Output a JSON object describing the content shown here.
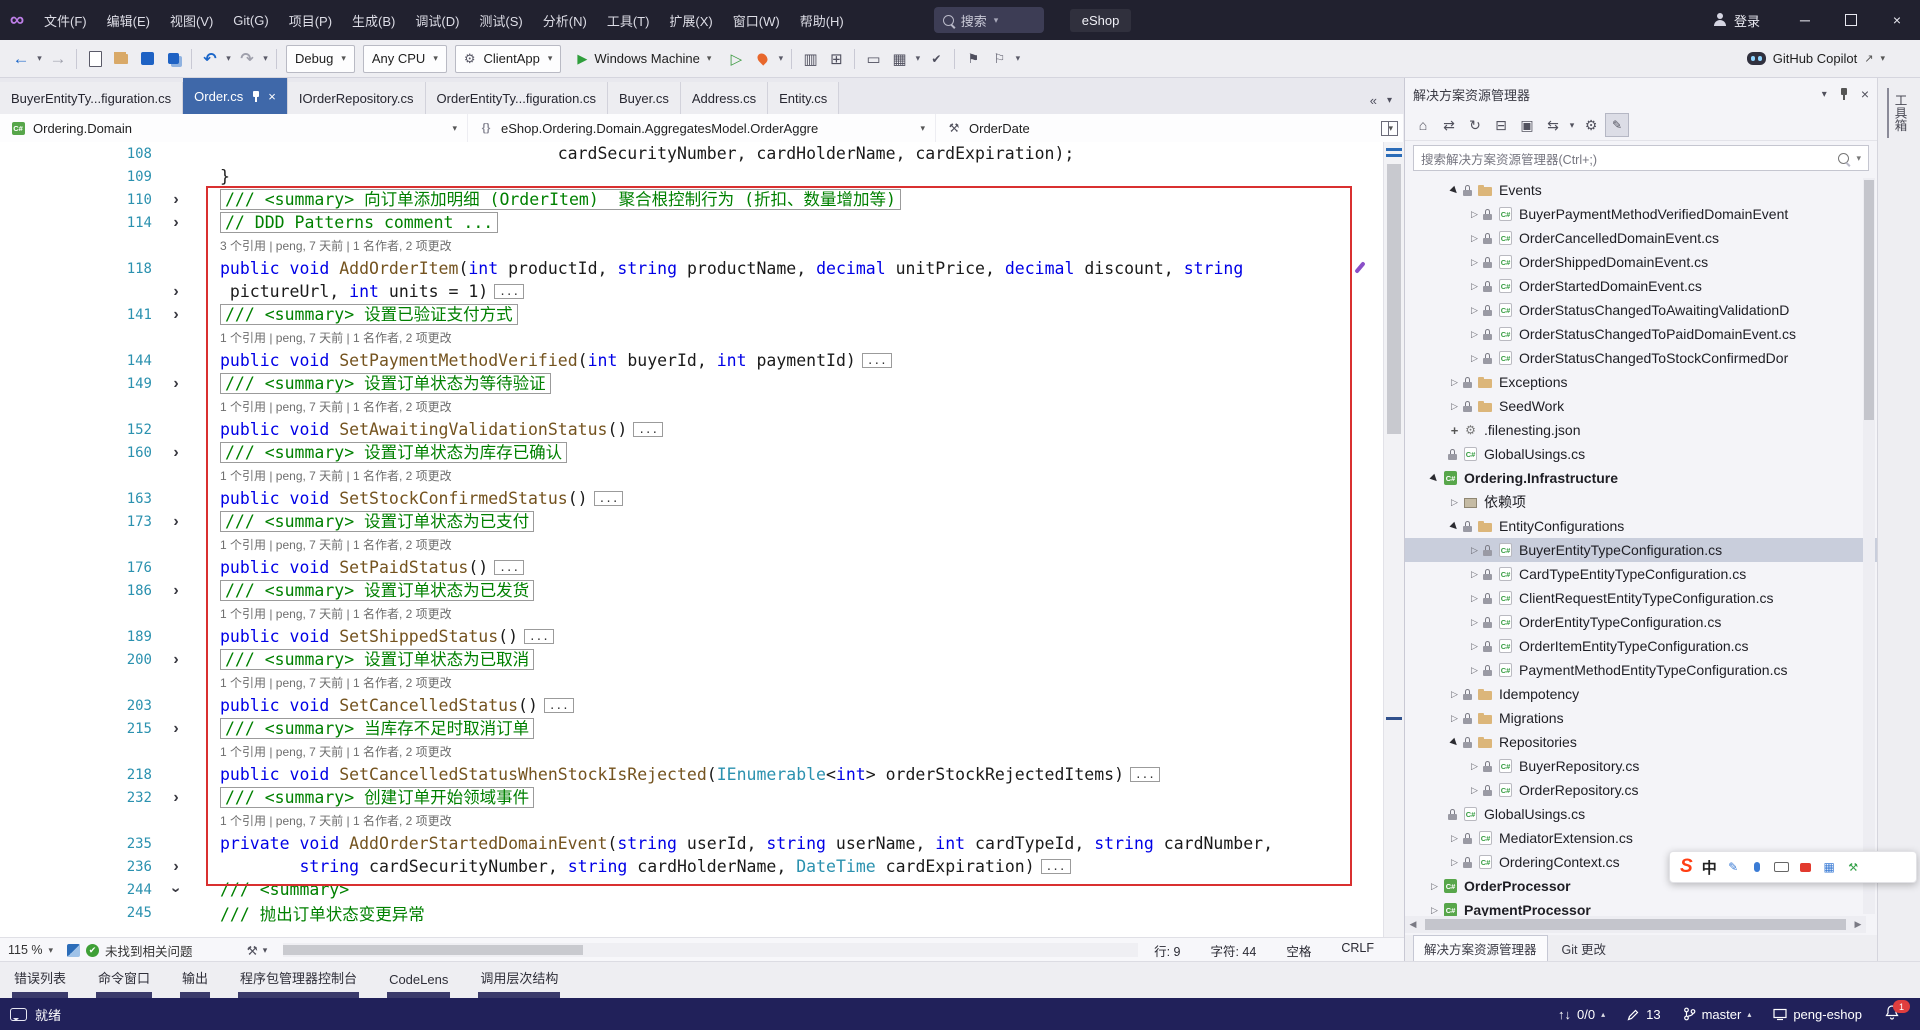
{
  "titlebar": {
    "menus": [
      "文件(F)",
      "编辑(E)",
      "视图(V)",
      "Git(G)",
      "项目(P)",
      "生成(B)",
      "调试(D)",
      "测试(S)",
      "分析(N)",
      "工具(T)",
      "扩展(X)",
      "窗口(W)",
      "帮助(H)"
    ],
    "search_label": "搜索",
    "solution": "eShop",
    "signin": "登录"
  },
  "toolbar": {
    "icons_a": [
      "back-icon",
      "caret-icon",
      "forward-icon",
      "separator",
      "new-file-icon",
      "open-folder-icon",
      "save-icon",
      "save-all-icon",
      "separator",
      "undo-icon",
      "caret-icon",
      "redo-icon",
      "caret-icon",
      "separator"
    ],
    "icons_b": [
      "play-outline-icon",
      "hot-reload-icon",
      "caret-icon",
      "separator",
      "profiler-icon",
      "pages-icon",
      "separator",
      "monitor-icon",
      "grid-icon",
      "caret-icon",
      "spell-icon",
      "separator",
      "bookmark-icon",
      "flag-icon",
      "caret-icon"
    ],
    "config": "Debug",
    "platform": "Any CPU",
    "profile": "ClientApp",
    "run_label": "Windows Machine",
    "copilot_label": "GitHub Copilot"
  },
  "tabs": [
    {
      "label": "BuyerEntityTy...figuration.cs",
      "state": ""
    },
    {
      "label": "Order.cs",
      "state": "active"
    },
    {
      "label": "IOrderRepository.cs",
      "state": ""
    },
    {
      "label": "OrderEntityTy...figuration.cs",
      "state": ""
    },
    {
      "label": "Buyer.cs",
      "state": ""
    },
    {
      "label": "Address.cs",
      "state": ""
    },
    {
      "label": "Entity.cs",
      "state": ""
    }
  ],
  "breadcrumb": {
    "crumbs": [
      {
        "label": "Ordering.Domain",
        "icon": "project-icon"
      },
      {
        "label": "eShop.Ordering.Domain.AggregatesModel.OrderAggre",
        "icon": "namespace-icon"
      },
      {
        "label": "OrderDate",
        "icon": "property-icon"
      }
    ]
  },
  "editor": {
    "ellipsis": "...",
    "lines": [
      {
        "num": "108",
        "chev": "",
        "cls": "",
        "ell": false,
        "segs": [
          {
            "t": "                                  cardSecurityNumber, cardHolderName, cardExpiration);",
            "c": "pl"
          }
        ]
      },
      {
        "num": "109",
        "chev": "",
        "cls": "",
        "ell": false,
        "segs": [
          {
            "t": "}",
            "c": "pl"
          }
        ]
      },
      {
        "num": "110",
        "chev": "r",
        "cls": "boxed",
        "ell": false,
        "segs": [
          {
            "t": "/// <summary> 向订单添加明细 (OrderItem)  聚合根控制行为 (折扣、数量增加等)",
            "c": "cm"
          }
        ]
      },
      {
        "num": "114",
        "chev": "r",
        "cls": "boxed",
        "ell": false,
        "segs": [
          {
            "t": "// DDD Patterns comment ...",
            "c": "cm"
          }
        ]
      },
      {
        "num": "",
        "chev": "",
        "cls": "lens",
        "ell": false,
        "segs": [
          {
            "t": "3 个引用 | peng, 7 天前 | 1 名作者, 2 项更改",
            "c": "lens"
          }
        ]
      },
      {
        "num": "118",
        "chev": "",
        "cls": "",
        "ell": false,
        "segs": [
          {
            "t": "public void ",
            "c": "kw"
          },
          {
            "t": "AddOrderItem",
            "c": "m"
          },
          {
            "t": "(",
            "c": "pl"
          },
          {
            "t": "int",
            "c": "kw"
          },
          {
            "t": " productId, ",
            "c": "pl"
          },
          {
            "t": "string",
            "c": "kw"
          },
          {
            "t": " productName, ",
            "c": "pl"
          },
          {
            "t": "decimal",
            "c": "kw"
          },
          {
            "t": " unitPrice, ",
            "c": "pl"
          },
          {
            "t": "decimal",
            "c": "kw"
          },
          {
            "t": " discount, ",
            "c": "pl"
          },
          {
            "t": "string",
            "c": "kw"
          }
        ]
      },
      {
        "num": "",
        "chev": "r",
        "cls": "",
        "ell": true,
        "segs": [
          {
            "t": " pictureUrl, ",
            "c": "pl"
          },
          {
            "t": "int",
            "c": "kw"
          },
          {
            "t": " units = 1)",
            "c": "pl"
          }
        ]
      },
      {
        "num": "141",
        "chev": "r",
        "cls": "boxed",
        "ell": false,
        "segs": [
          {
            "t": "/// <summary> 设置已验证支付方式",
            "c": "cm"
          }
        ]
      },
      {
        "num": "",
        "chev": "",
        "cls": "lens",
        "ell": false,
        "segs": [
          {
            "t": "1 个引用 | peng, 7 天前 | 1 名作者, 2 项更改",
            "c": "lens"
          }
        ]
      },
      {
        "num": "144",
        "chev": "",
        "cls": "",
        "ell": true,
        "segs": [
          {
            "t": "public void ",
            "c": "kw"
          },
          {
            "t": "SetPaymentMethodVerified",
            "c": "m"
          },
          {
            "t": "(",
            "c": "pl"
          },
          {
            "t": "int",
            "c": "kw"
          },
          {
            "t": " buyerId, ",
            "c": "pl"
          },
          {
            "t": "int",
            "c": "kw"
          },
          {
            "t": " paymentId)",
            "c": "pl"
          }
        ]
      },
      {
        "num": "149",
        "chev": "r",
        "cls": "boxed",
        "ell": false,
        "segs": [
          {
            "t": "/// <summary> 设置订单状态为等待验证",
            "c": "cm"
          }
        ]
      },
      {
        "num": "",
        "chev": "",
        "cls": "lens",
        "ell": false,
        "segs": [
          {
            "t": "1 个引用 | peng, 7 天前 | 1 名作者, 2 项更改",
            "c": "lens"
          }
        ]
      },
      {
        "num": "152",
        "chev": "",
        "cls": "",
        "ell": true,
        "segs": [
          {
            "t": "public void ",
            "c": "kw"
          },
          {
            "t": "SetAwaitingValidationStatus",
            "c": "m"
          },
          {
            "t": "()",
            "c": "pl"
          }
        ]
      },
      {
        "num": "160",
        "chev": "r",
        "cls": "boxed",
        "ell": false,
        "segs": [
          {
            "t": "/// <summary> 设置订单状态为库存已确认",
            "c": "cm"
          }
        ]
      },
      {
        "num": "",
        "chev": "",
        "cls": "lens",
        "ell": false,
        "segs": [
          {
            "t": "1 个引用 | peng, 7 天前 | 1 名作者, 2 项更改",
            "c": "lens"
          }
        ]
      },
      {
        "num": "163",
        "chev": "",
        "cls": "",
        "ell": true,
        "segs": [
          {
            "t": "public void ",
            "c": "kw"
          },
          {
            "t": "SetStockConfirmedStatus",
            "c": "m"
          },
          {
            "t": "()",
            "c": "pl"
          }
        ]
      },
      {
        "num": "173",
        "chev": "r",
        "cls": "boxed",
        "ell": false,
        "segs": [
          {
            "t": "/// <summary> 设置订单状态为已支付",
            "c": "cm"
          }
        ]
      },
      {
        "num": "",
        "chev": "",
        "cls": "lens",
        "ell": false,
        "segs": [
          {
            "t": "1 个引用 | peng, 7 天前 | 1 名作者, 2 项更改",
            "c": "lens"
          }
        ]
      },
      {
        "num": "176",
        "chev": "",
        "cls": "",
        "ell": true,
        "segs": [
          {
            "t": "public void ",
            "c": "kw"
          },
          {
            "t": "SetPaidStatus",
            "c": "m"
          },
          {
            "t": "()",
            "c": "pl"
          }
        ]
      },
      {
        "num": "186",
        "chev": "r",
        "cls": "boxed",
        "ell": false,
        "segs": [
          {
            "t": "/// <summary> 设置订单状态为已发货",
            "c": "cm"
          }
        ]
      },
      {
        "num": "",
        "chev": "",
        "cls": "lens",
        "ell": false,
        "segs": [
          {
            "t": "1 个引用 | peng, 7 天前 | 1 名作者, 2 项更改",
            "c": "lens"
          }
        ]
      },
      {
        "num": "189",
        "chev": "",
        "cls": "",
        "ell": true,
        "segs": [
          {
            "t": "public void ",
            "c": "kw"
          },
          {
            "t": "SetShippedStatus",
            "c": "m"
          },
          {
            "t": "()",
            "c": "pl"
          }
        ]
      },
      {
        "num": "200",
        "chev": "r",
        "cls": "boxed",
        "ell": false,
        "segs": [
          {
            "t": "/// <summary> 设置订单状态为已取消",
            "c": "cm"
          }
        ]
      },
      {
        "num": "",
        "chev": "",
        "cls": "lens",
        "ell": false,
        "segs": [
          {
            "t": "1 个引用 | peng, 7 天前 | 1 名作者, 2 项更改",
            "c": "lens"
          }
        ]
      },
      {
        "num": "203",
        "chev": "",
        "cls": "",
        "ell": true,
        "segs": [
          {
            "t": "public void ",
            "c": "kw"
          },
          {
            "t": "SetCancelledStatus",
            "c": "m"
          },
          {
            "t": "()",
            "c": "pl"
          }
        ]
      },
      {
        "num": "215",
        "chev": "r",
        "cls": "boxed",
        "ell": false,
        "segs": [
          {
            "t": "/// <summary> 当库存不足时取消订单",
            "c": "cm"
          }
        ]
      },
      {
        "num": "",
        "chev": "",
        "cls": "lens",
        "ell": false,
        "segs": [
          {
            "t": "1 个引用 | peng, 7 天前 | 1 名作者, 2 项更改",
            "c": "lens"
          }
        ]
      },
      {
        "num": "218",
        "chev": "",
        "cls": "",
        "ell": true,
        "segs": [
          {
            "t": "public void ",
            "c": "kw"
          },
          {
            "t": "SetCancelledStatusWhenStockIsRejected",
            "c": "m"
          },
          {
            "t": "(",
            "c": "pl"
          },
          {
            "t": "IEnumerable",
            "c": "ty"
          },
          {
            "t": "<",
            "c": "pl"
          },
          {
            "t": "int",
            "c": "kw"
          },
          {
            "t": "> orderStockRejectedItems)",
            "c": "pl"
          }
        ]
      },
      {
        "num": "232",
        "chev": "r",
        "cls": "boxed",
        "ell": false,
        "segs": [
          {
            "t": "/// <summary> 创建订单开始领域事件",
            "c": "cm"
          }
        ]
      },
      {
        "num": "",
        "chev": "",
        "cls": "lens",
        "ell": false,
        "segs": [
          {
            "t": "1 个引用 | peng, 7 天前 | 1 名作者, 2 项更改",
            "c": "lens"
          }
        ]
      },
      {
        "num": "235",
        "chev": "",
        "cls": "",
        "ell": false,
        "segs": [
          {
            "t": "private void ",
            "c": "kw"
          },
          {
            "t": "AddOrderStartedDomainEvent",
            "c": "m"
          },
          {
            "t": "(",
            "c": "pl"
          },
          {
            "t": "string",
            "c": "kw"
          },
          {
            "t": " userId, ",
            "c": "pl"
          },
          {
            "t": "string",
            "c": "kw"
          },
          {
            "t": " userName, ",
            "c": "pl"
          },
          {
            "t": "int",
            "c": "kw"
          },
          {
            "t": " cardTypeId, ",
            "c": "pl"
          },
          {
            "t": "string",
            "c": "kw"
          },
          {
            "t": " cardNumber,",
            "c": "pl"
          }
        ]
      },
      {
        "num": "236",
        "chev": "r",
        "cls": "",
        "ell": true,
        "segs": [
          {
            "t": "        ",
            "c": "pl"
          },
          {
            "t": "string",
            "c": "kw"
          },
          {
            "t": " cardSecurityNumber, ",
            "c": "pl"
          },
          {
            "t": "string",
            "c": "kw"
          },
          {
            "t": " cardHolderName, ",
            "c": "pl"
          },
          {
            "t": "DateTime",
            "c": "ty"
          },
          {
            "t": " cardExpiration)",
            "c": "pl"
          }
        ]
      },
      {
        "num": "244",
        "chev": "d",
        "cls": "",
        "ell": false,
        "segs": [
          {
            "t": "/// <summary>",
            "c": "cm"
          }
        ]
      },
      {
        "num": "245",
        "chev": "",
        "cls": "",
        "ell": false,
        "segs": [
          {
            "t": "/// 抛出订单状态变更异常",
            "c": "cm"
          }
        ]
      }
    ]
  },
  "editor_status": {
    "zoom": "115 %",
    "health": "未找到相关问题",
    "line": "行: 9",
    "column": "字符: 44",
    "spaces": "空格",
    "eol": "CRLF"
  },
  "solution_explorer": {
    "title": "解决方案资源管理器",
    "tool_icons": [
      "home-icon",
      "switch-icon",
      "refresh-icon",
      "collapse-all-icon",
      "copy-icon",
      "sync-icon",
      "caret-icon",
      "gear-icon",
      "preview-icon"
    ],
    "search_placeholder": "搜索解决方案资源管理器(Ctrl+;)",
    "tree": [
      {
        "label": "Events",
        "ind": 42,
        "chev": "d",
        "icon": "folder-icon",
        "lock": true,
        "state": ""
      },
      {
        "label": "BuyerPaymentMethodVerifiedDomainEvent",
        "ind": 62,
        "chev": "r",
        "icon": "cs-icon",
        "lock": true,
        "state": ""
      },
      {
        "label": "OrderCancelledDomainEvent.cs",
        "ind": 62,
        "chev": "r",
        "icon": "cs-icon",
        "lock": true,
        "state": ""
      },
      {
        "label": "OrderShippedDomainEvent.cs",
        "ind": 62,
        "chev": "r",
        "icon": "cs-icon",
        "lock": true,
        "state": ""
      },
      {
        "label": "OrderStartedDomainEvent.cs",
        "ind": 62,
        "chev": "r",
        "icon": "cs-icon",
        "lock": true,
        "state": ""
      },
      {
        "label": "OrderStatusChangedToAwaitingValidationD",
        "ind": 62,
        "chev": "r",
        "icon": "cs-icon",
        "lock": true,
        "state": ""
      },
      {
        "label": "OrderStatusChangedToPaidDomainEvent.cs",
        "ind": 62,
        "chev": "r",
        "icon": "cs-icon",
        "lock": true,
        "state": ""
      },
      {
        "label": "OrderStatusChangedToStockConfirmedDor",
        "ind": 62,
        "chev": "r",
        "icon": "cs-icon",
        "lock": true,
        "state": ""
      },
      {
        "label": "Exceptions",
        "ind": 42,
        "chev": "r",
        "icon": "folder-icon",
        "lock": true,
        "state": ""
      },
      {
        "label": "SeedWork",
        "ind": 42,
        "chev": "r",
        "icon": "folder-icon",
        "lock": true,
        "state": ""
      },
      {
        "label": ".filenesting.json",
        "ind": 42,
        "chev": "plus",
        "icon": "json-icon",
        "lock": false,
        "state": ""
      },
      {
        "label": "GlobalUsings.cs",
        "ind": 42,
        "chev": "",
        "icon": "cs-icon",
        "lock": true,
        "state": ""
      },
      {
        "label": "Ordering.Infrastructure",
        "ind": 22,
        "chev": "d",
        "icon": "project-icon",
        "lock": false,
        "state": "bold"
      },
      {
        "label": "依赖项",
        "ind": 42,
        "chev": "r",
        "icon": "package-icon",
        "lock": false,
        "state": ""
      },
      {
        "label": "EntityConfigurations",
        "ind": 42,
        "chev": "d",
        "icon": "folder-icon",
        "lock": true,
        "state": ""
      },
      {
        "label": "BuyerEntityTypeConfiguration.cs",
        "ind": 62,
        "chev": "r",
        "icon": "cs-icon",
        "lock": true,
        "state": "selected"
      },
      {
        "label": "CardTypeEntityTypeConfiguration.cs",
        "ind": 62,
        "chev": "r",
        "icon": "cs-icon",
        "lock": true,
        "state": ""
      },
      {
        "label": "ClientRequestEntityTypeConfiguration.cs",
        "ind": 62,
        "chev": "r",
        "icon": "cs-icon",
        "lock": true,
        "state": ""
      },
      {
        "label": "OrderEntityTypeConfiguration.cs",
        "ind": 62,
        "chev": "r",
        "icon": "cs-icon",
        "lock": true,
        "state": ""
      },
      {
        "label": "OrderItemEntityTypeConfiguration.cs",
        "ind": 62,
        "chev": "r",
        "icon": "cs-icon",
        "lock": true,
        "state": ""
      },
      {
        "label": "PaymentMethodEntityTypeConfiguration.cs",
        "ind": 62,
        "chev": "r",
        "icon": "cs-icon",
        "lock": true,
        "state": ""
      },
      {
        "label": "Idempotency",
        "ind": 42,
        "chev": "r",
        "icon": "folder-icon",
        "lock": true,
        "state": ""
      },
      {
        "label": "Migrations",
        "ind": 42,
        "chev": "r",
        "icon": "folder-icon",
        "lock": true,
        "state": ""
      },
      {
        "label": "Repositories",
        "ind": 42,
        "chev": "d",
        "icon": "folder-icon",
        "lock": true,
        "state": ""
      },
      {
        "label": "BuyerRepository.cs",
        "ind": 62,
        "chev": "r",
        "icon": "cs-icon",
        "lock": true,
        "state": ""
      },
      {
        "label": "OrderRepository.cs",
        "ind": 62,
        "chev": "r",
        "icon": "cs-icon",
        "lock": true,
        "state": ""
      },
      {
        "label": "GlobalUsings.cs",
        "ind": 42,
        "chev": "",
        "icon": "cs-icon",
        "lock": true,
        "state": ""
      },
      {
        "label": "MediatorExtension.cs",
        "ind": 42,
        "chev": "r",
        "icon": "cs-icon",
        "lock": true,
        "state": ""
      },
      {
        "label": "OrderingContext.cs",
        "ind": 42,
        "chev": "r",
        "icon": "cs-icon",
        "lock": true,
        "state": ""
      },
      {
        "label": "OrderProcessor",
        "ind": 22,
        "chev": "r",
        "icon": "project-icon",
        "lock": false,
        "state": "bold"
      },
      {
        "label": "PaymentProcessor",
        "ind": 22,
        "chev": "r",
        "icon": "project-icon",
        "lock": false,
        "state": "bold"
      }
    ],
    "bottom_tabs": [
      {
        "label": "解决方案资源管理器",
        "state": "active"
      },
      {
        "label": "Git 更改",
        "state": ""
      }
    ]
  },
  "right_strip": {
    "label": "工具箱"
  },
  "panel_tabs": [
    "错误列表",
    "命令窗口",
    "输出",
    "程序包管理器控制台",
    "CodeLens",
    "调用层次结构"
  ],
  "statusbar": {
    "ready": "就绪",
    "sync": "0/0",
    "edits": "13",
    "branch": "master",
    "repo": "peng-eshop",
    "badge": "1"
  },
  "ime": {
    "logo": "S",
    "mode": "中",
    "icons": [
      "pen-icon",
      "mic-icon",
      "keyboard-icon",
      "toolbox-icon",
      "grid-icon",
      "wrench-icon"
    ]
  }
}
